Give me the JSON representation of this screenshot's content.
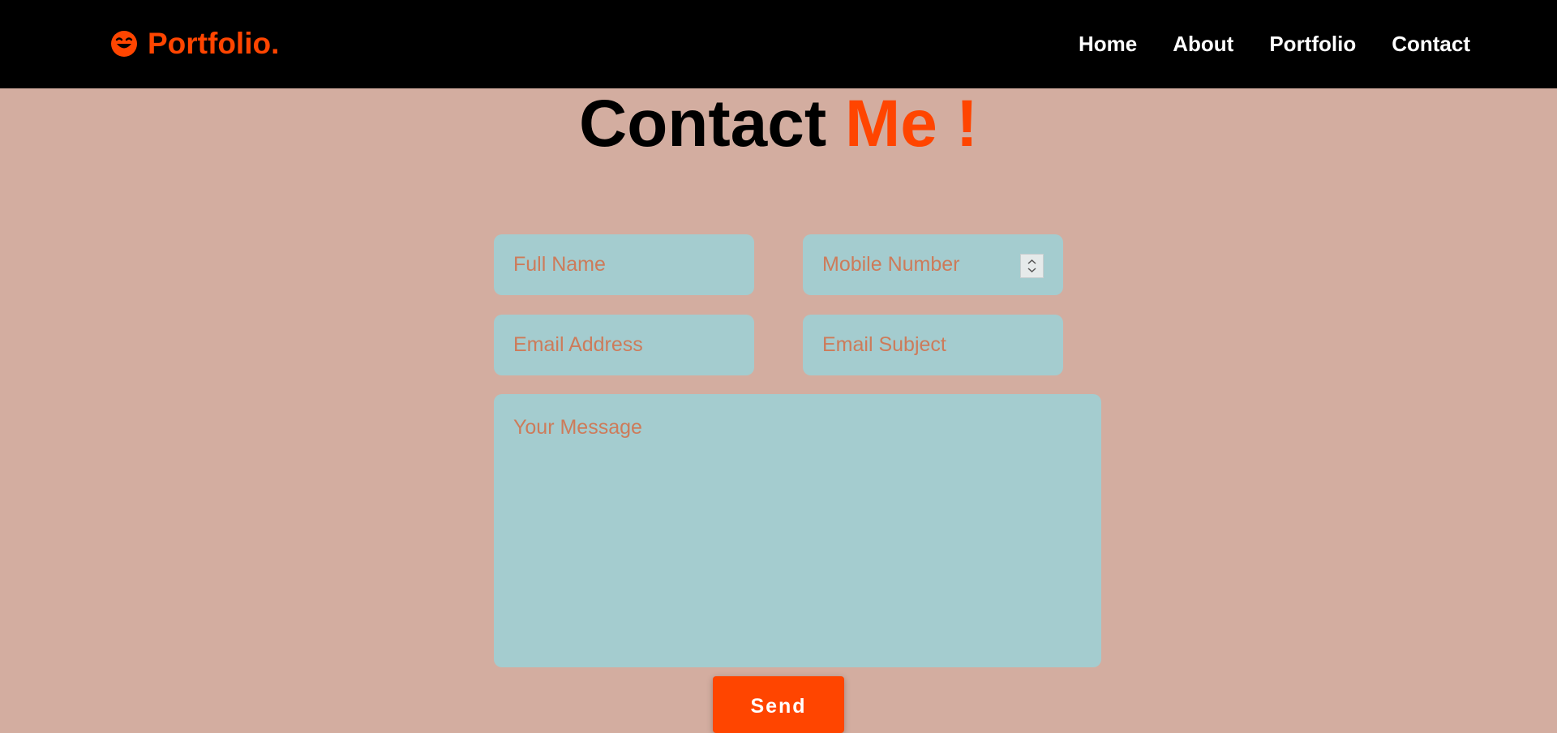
{
  "header": {
    "logo_text": "Portfolio.",
    "logo_icon": "smiley-face-icon",
    "nav": [
      {
        "label": "Home"
      },
      {
        "label": "About"
      },
      {
        "label": "Portfolio"
      },
      {
        "label": "Contact"
      }
    ]
  },
  "contact": {
    "title_main": "Contact",
    "title_accent": "Me !",
    "fields": {
      "full_name": {
        "placeholder": "Full Name",
        "value": ""
      },
      "mobile_number": {
        "placeholder": "Mobile Number",
        "value": ""
      },
      "email_address": {
        "placeholder": "Email Address",
        "value": ""
      },
      "email_subject": {
        "placeholder": "Email Subject",
        "value": ""
      },
      "message": {
        "placeholder": "Your Message",
        "value": ""
      }
    },
    "send_label": "Send"
  },
  "colors": {
    "accent": "#ff4500",
    "background": "#d3ada0",
    "header_bg": "#000000",
    "field_bg": "#a4cccf",
    "placeholder": "#cd7b5a"
  }
}
